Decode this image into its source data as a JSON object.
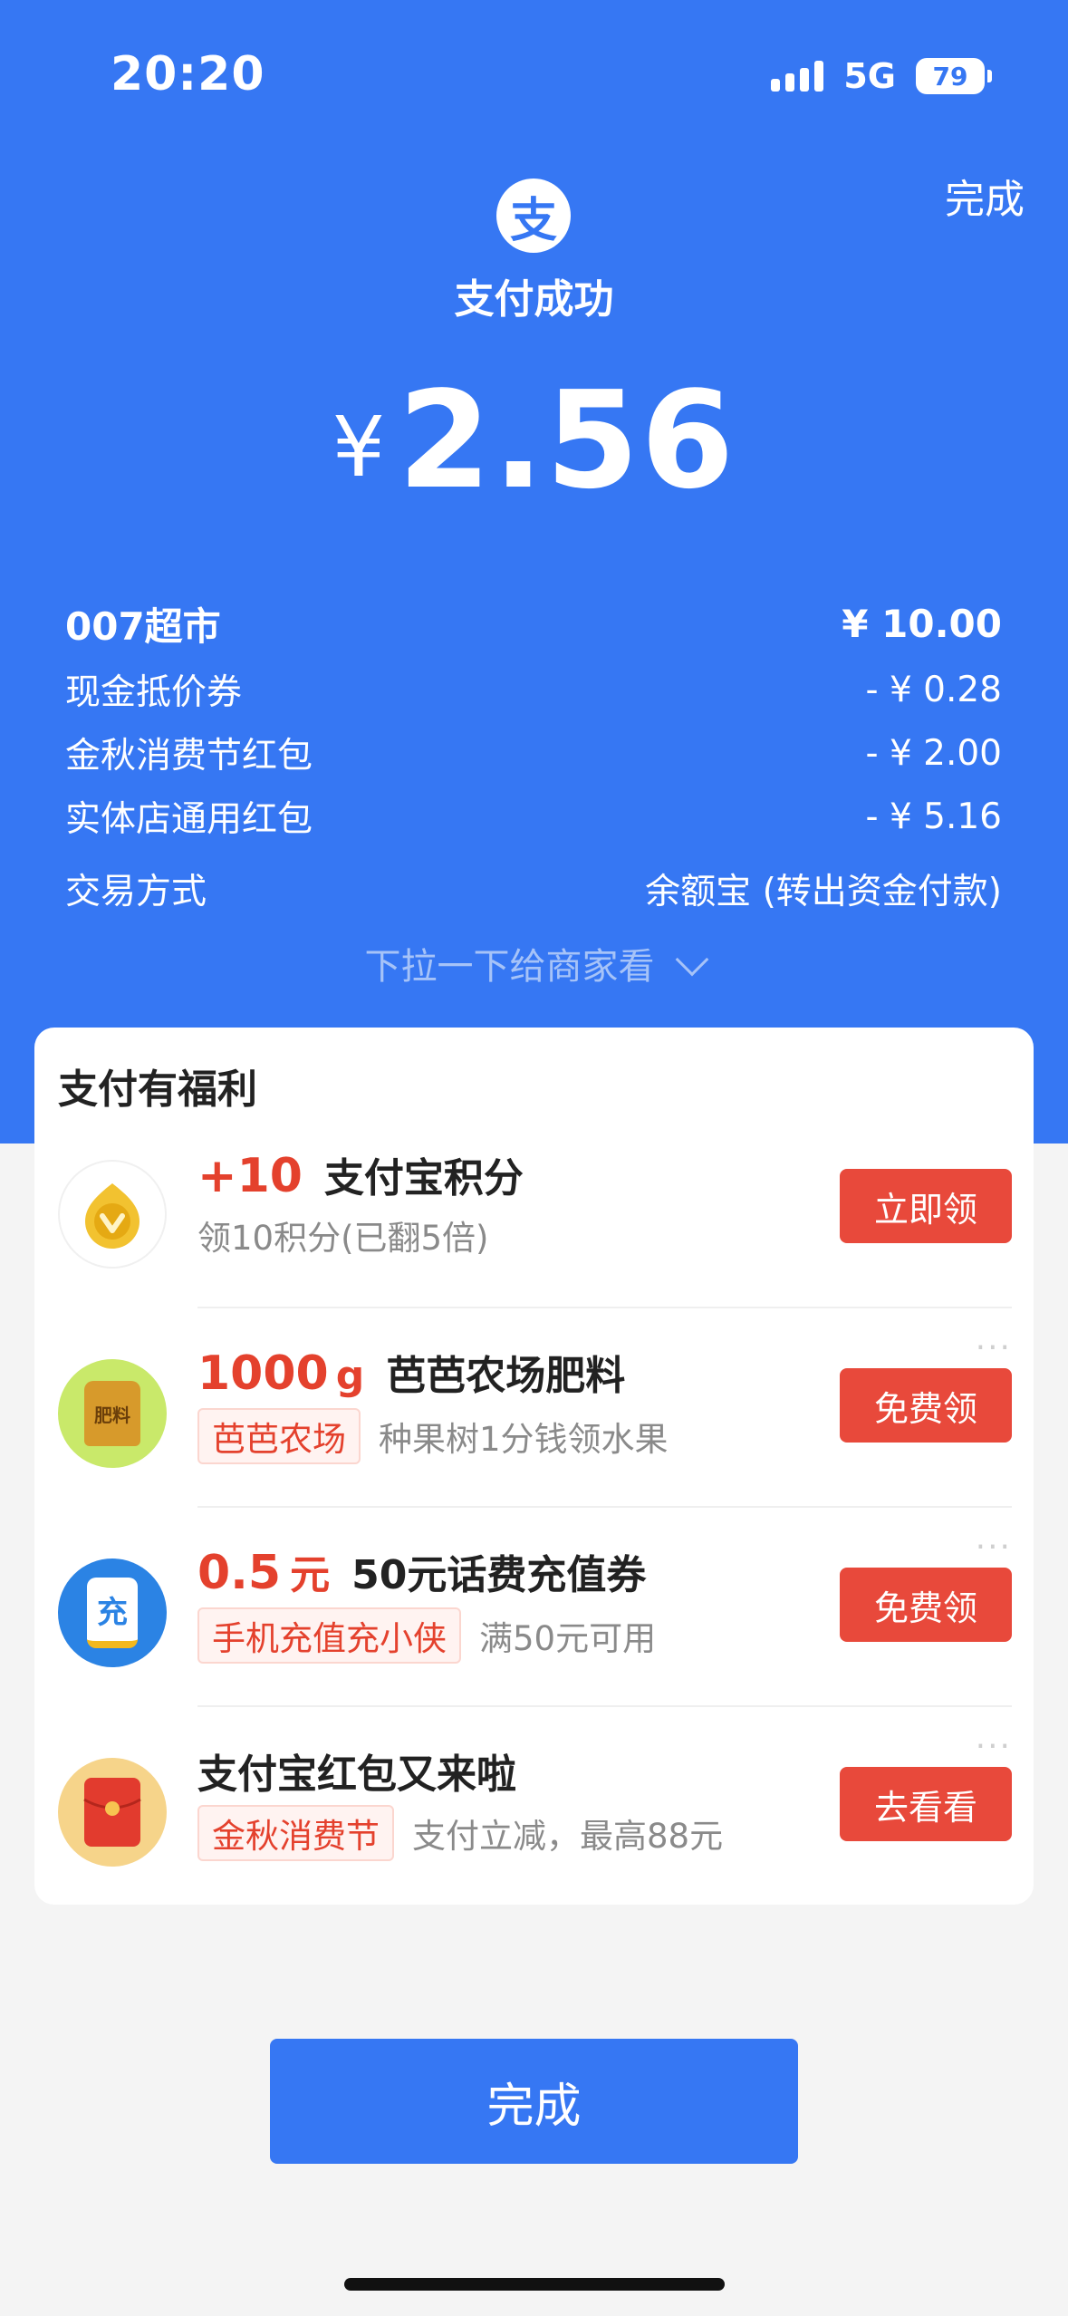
{
  "status": {
    "time": "20:20",
    "network": "5G",
    "battery": "79"
  },
  "header": {
    "done_label": "完成",
    "logo_glyph": "支",
    "title": "支付成功",
    "currency": "¥",
    "amount": "2.56"
  },
  "details": [
    {
      "label": "007超市",
      "value": "¥ 10.00"
    },
    {
      "label": "现金抵价券",
      "value": "- ¥ 0.28"
    },
    {
      "label": "金秋消费节红包",
      "value": "- ¥ 2.00"
    },
    {
      "label": "实体店通用红包",
      "value": "- ¥ 5.16"
    },
    {
      "label": "交易方式",
      "value": "余额宝 (转出资金付款)"
    }
  ],
  "pulldown_hint": "下拉一下给商家看",
  "benefits": {
    "title": "支付有福利",
    "items": [
      {
        "highlight": "+10",
        "name": "支付宝积分",
        "tag": "",
        "sub": "领10积分(已翻5倍)",
        "button": "立即领",
        "icon": "gold-coin-icon"
      },
      {
        "highlight": "1000",
        "highlight_unit": "g",
        "name": "芭芭农场肥料",
        "tag": "芭芭农场",
        "sub": "种果树1分钱领水果",
        "button": "免费领",
        "icon_text": "肥料",
        "icon": "fertilizer-bag-icon"
      },
      {
        "highlight": "0.5",
        "highlight_unit": "元",
        "name": "50元话费充值券",
        "tag": "手机充值充小侠",
        "sub": "满50元可用",
        "button": "免费领",
        "icon_text": "充",
        "icon": "phone-recharge-icon"
      },
      {
        "highlight": "",
        "name": "支付宝红包又来啦",
        "tag": "金秋消费节",
        "sub": "支付立减，最高88元",
        "button": "去看看",
        "icon": "red-envelope-icon"
      }
    ]
  },
  "footer": {
    "done_label": "完成"
  },
  "colors": {
    "primary": "#3677f3",
    "accent_red": "#e8493b",
    "background": "#f4f4f4"
  }
}
